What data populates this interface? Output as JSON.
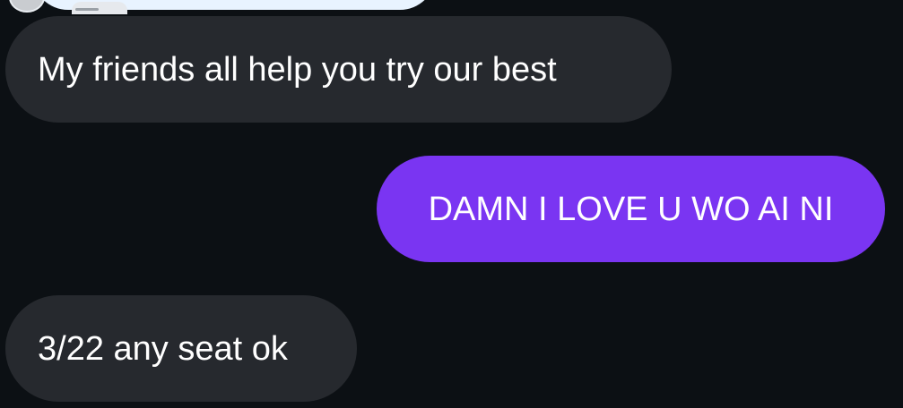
{
  "messages": [
    {
      "direction": "incoming",
      "text": "My friends all help you try our best"
    },
    {
      "direction": "outgoing",
      "text": "DAMN I LOVE U WO AI NI"
    },
    {
      "direction": "incoming",
      "text": "3/22 any seat ok"
    }
  ],
  "colors": {
    "background": "#0c1014",
    "incoming_bubble": "#26292e",
    "outgoing_bubble": "#7a35f2",
    "text": "#ffffff"
  }
}
